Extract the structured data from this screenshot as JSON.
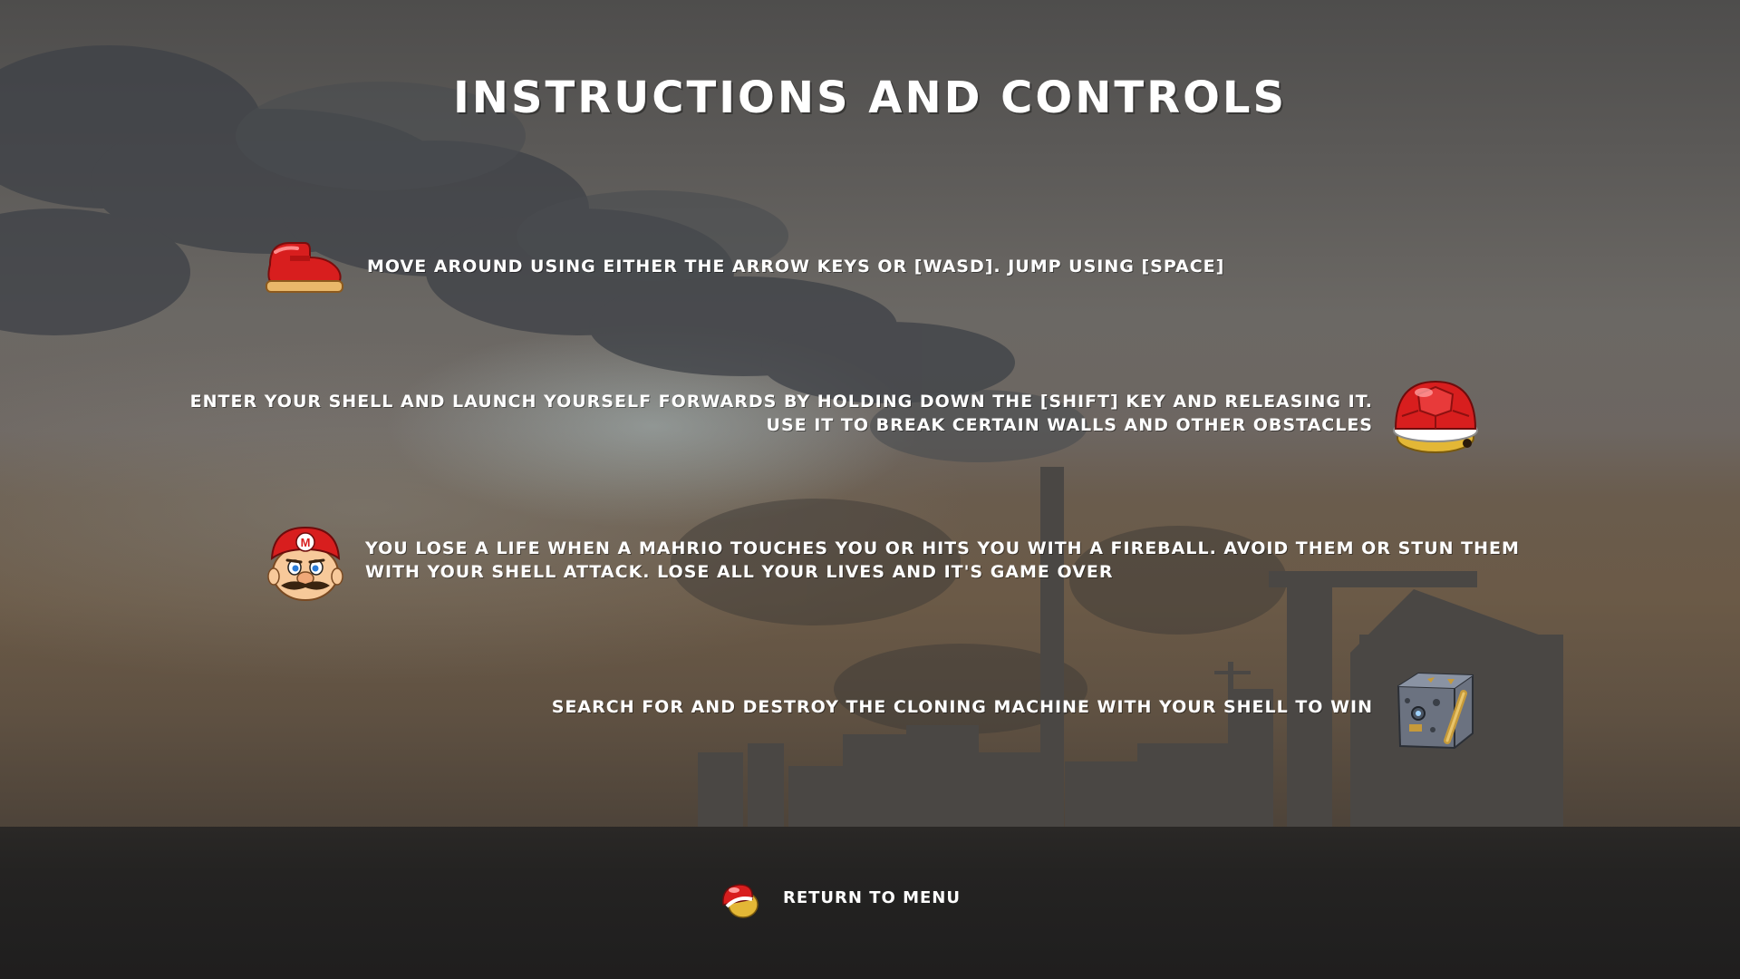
{
  "title": "Instructions and Controls",
  "instructions": [
    {
      "icon": "boot-icon",
      "lines": [
        "Move around using either the arrow keys or [WASD]. Jump using [Space]"
      ]
    },
    {
      "icon": "red-shell-icon",
      "lines": [
        "Enter your shell and launch yourself forwards by holding down the [Shift] key and releasing it.",
        "Use it to break certain walls and other obstacles"
      ]
    },
    {
      "icon": "mario-face-icon",
      "lines": [
        "You lose a life when a Mahrio touches you or hits you with a fireball. Avoid them or stun them",
        "with your shell attack. Lose all your lives and it's game over"
      ]
    },
    {
      "icon": "cloning-machine-icon",
      "lines": [
        "Search for and destroy the cloning machine with your shell to win"
      ]
    }
  ],
  "menu": {
    "icon": "shell-cursor-icon",
    "return_label": "Return to Menu"
  },
  "colors": {
    "text": "#ffffff",
    "shell_red": "#d81e1e",
    "ground": "#222120"
  }
}
